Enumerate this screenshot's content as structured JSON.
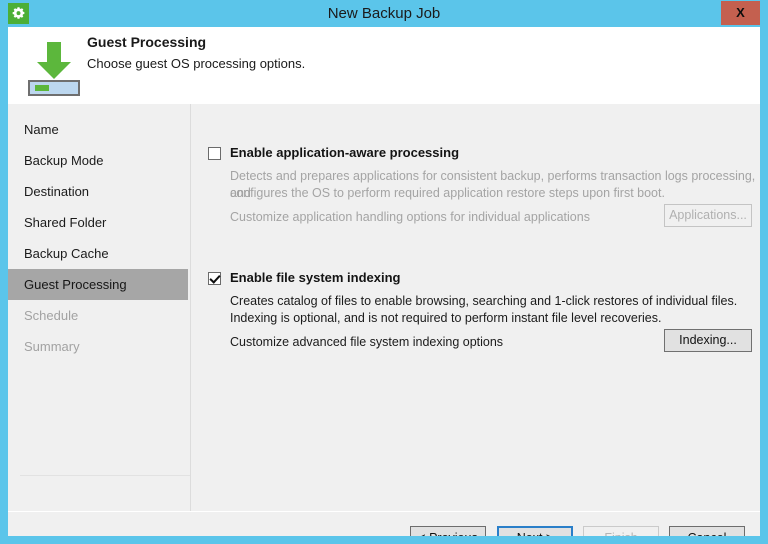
{
  "window": {
    "title": "New Backup Job",
    "app_icon": "gear-icon",
    "close_label": "X",
    "frame_color": "#5bc5ea",
    "client_bg": "#f0f0f0"
  },
  "header": {
    "icon": "download-arrow-to-drive-icon",
    "title": "Guest Processing",
    "subtitle": "Choose guest OS processing options."
  },
  "sidebar": {
    "items": [
      {
        "label": "Name",
        "state": "normal"
      },
      {
        "label": "Backup Mode",
        "state": "normal"
      },
      {
        "label": "Destination",
        "state": "normal"
      },
      {
        "label": "Shared Folder",
        "state": "normal"
      },
      {
        "label": "Backup Cache",
        "state": "normal"
      },
      {
        "label": "Guest Processing",
        "state": "selected"
      },
      {
        "label": "Schedule",
        "state": "disabled"
      },
      {
        "label": "Summary",
        "state": "disabled"
      }
    ],
    "selected_color": "#a6a6a6",
    "disabled_color": "#a2a2a2"
  },
  "content": {
    "app_aware": {
      "checkbox_label": "Enable application-aware processing",
      "checked": false,
      "description_line1": "Detects and prepares applications for consistent backup, performs transaction logs processing, and",
      "description_line2": "configures the OS to perform required application restore steps upon first boot.",
      "customize_text": "Customize application handling options for individual applications",
      "button_label": "Applications...",
      "button_enabled": false
    },
    "file_indexing": {
      "checkbox_label": "Enable file system indexing",
      "checked": true,
      "description_line1": "Creates catalog of files to enable browsing, searching and 1-click restores of individual files.",
      "description_line2": "Indexing is optional, and is not required to perform instant file level recoveries.",
      "customize_text": "Customize advanced file system indexing options",
      "button_label": "Indexing...",
      "button_enabled": true
    }
  },
  "footer": {
    "previous_label": "< Previous",
    "next_label": "Next >",
    "finish_label": "Finish",
    "cancel_label": "Cancel",
    "finish_enabled": false,
    "focus_button": "Next >",
    "focus_color": "#2a7fc9"
  }
}
